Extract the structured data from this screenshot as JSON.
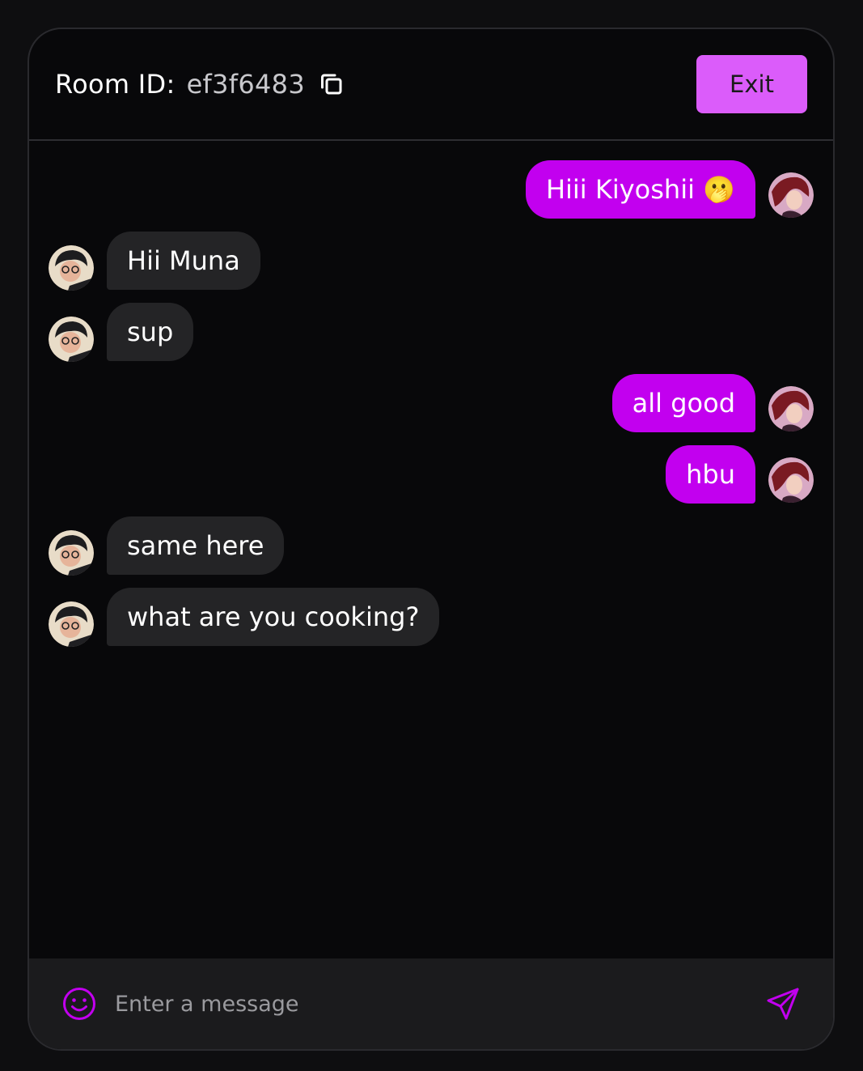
{
  "header": {
    "room_label": "Room ID:",
    "room_id": "ef3f6483",
    "exit_label": "Exit"
  },
  "messages": [
    {
      "sender": "me",
      "text": "Hiii Kiyoshii 🫢"
    },
    {
      "sender": "them",
      "text": "Hii Muna"
    },
    {
      "sender": "them",
      "text": "sup"
    },
    {
      "sender": "me",
      "text": "all good"
    },
    {
      "sender": "me",
      "text": "hbu"
    },
    {
      "sender": "them",
      "text": "same here"
    },
    {
      "sender": "them",
      "text": "what are you cooking?"
    }
  ],
  "composer": {
    "placeholder": "Enter a message",
    "value": ""
  },
  "colors": {
    "accent": "#c200ef",
    "exit_button": "#db5cfa",
    "other_bubble": "#242426",
    "background": "#08080a"
  },
  "icons": [
    "copy-icon",
    "smiley-icon",
    "send-icon"
  ]
}
